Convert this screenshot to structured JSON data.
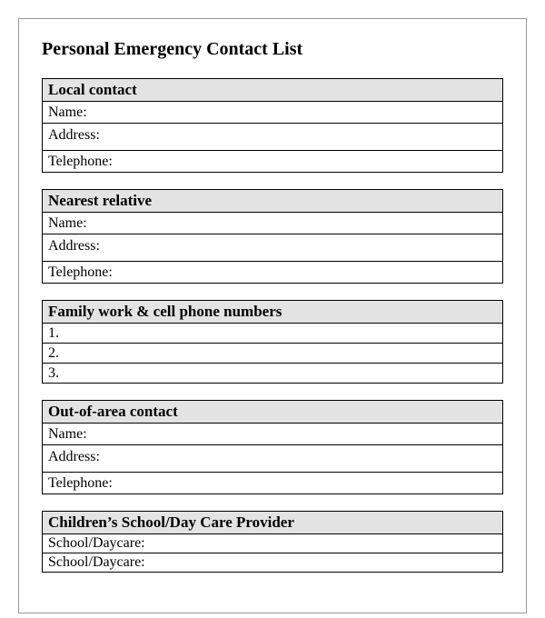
{
  "title": "Personal Emergency Contact List",
  "sections": {
    "local": {
      "header": "Local contact",
      "fields": {
        "name": "Name:",
        "address": "Address:",
        "telephone": "Telephone:"
      }
    },
    "relative": {
      "header": "Nearest relative",
      "fields": {
        "name": "Name:",
        "address": "Address:",
        "telephone": "Telephone:"
      }
    },
    "phones": {
      "header": "Family work & cell phone numbers",
      "rows": [
        "1.",
        "2.",
        "3."
      ]
    },
    "outarea": {
      "header": "Out-of-area contact",
      "fields": {
        "name": "Name:",
        "address": "Address:",
        "telephone": "Telephone:"
      }
    },
    "school": {
      "header": "Children’s School/Day Care Provider",
      "rows": [
        "School/Daycare:",
        "School/Daycare:"
      ]
    }
  }
}
